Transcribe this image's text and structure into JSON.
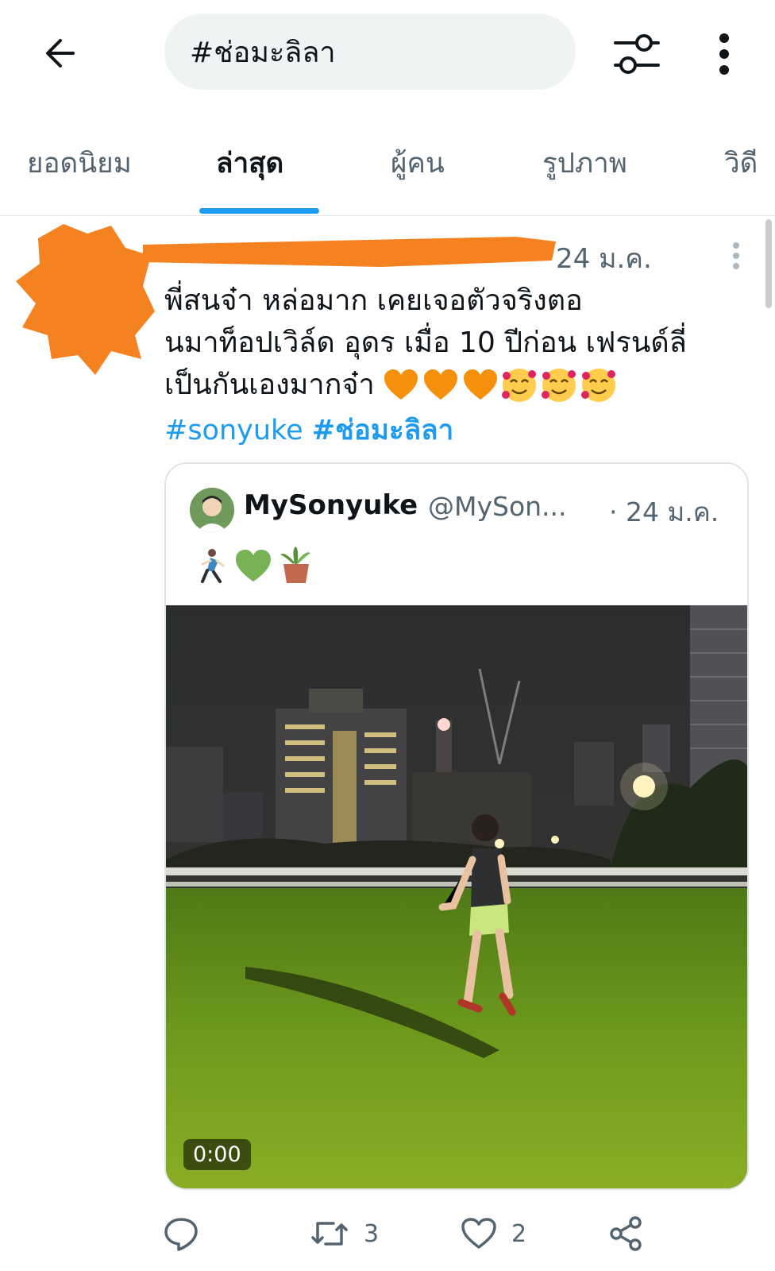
{
  "search": {
    "query": "#ช่อมะลิลา"
  },
  "tabs": [
    {
      "label": "ยอดนิยม",
      "active": false
    },
    {
      "label": "ล่าสุด",
      "active": true
    },
    {
      "label": "ผู้คน",
      "active": false
    },
    {
      "label": "รูปภาพ",
      "active": false
    },
    {
      "label": "วิดี",
      "active": false
    }
  ],
  "tweet": {
    "time": "24 ม.ค.",
    "text_lines": [
      "พี่สนจ๋า หล่อมาก เคยเจอตัวจริงตอ",
      "นมาท็อปเวิล์ด  อุดร เมื่อ 10 ปีก่อน เฟรนด์ลี่",
      "เป็นกันเองมากจ๋า"
    ],
    "hashtags": [
      "#sonyuke",
      "#ช่อมะลิลา"
    ],
    "emoji_names": [
      "orange-heart",
      "orange-heart",
      "orange-heart",
      "smiling-face-with-hearts",
      "smiling-face-with-hearts",
      "smiling-face-with-hearts"
    ],
    "actions": {
      "retweets": "3",
      "likes": "2"
    }
  },
  "quoted": {
    "name": "MySonyuke",
    "handle": "@MySon...",
    "time": "· 24 ม.ค.",
    "emoji_names": [
      "person-running",
      "green-heart",
      "potted-plant"
    ],
    "video_time": "0:00"
  },
  "colors": {
    "accent": "#1d9bf0",
    "text_primary": "#0f1419",
    "text_secondary": "#536471",
    "redaction": "#f58220",
    "search_bg": "#eff3f4"
  }
}
